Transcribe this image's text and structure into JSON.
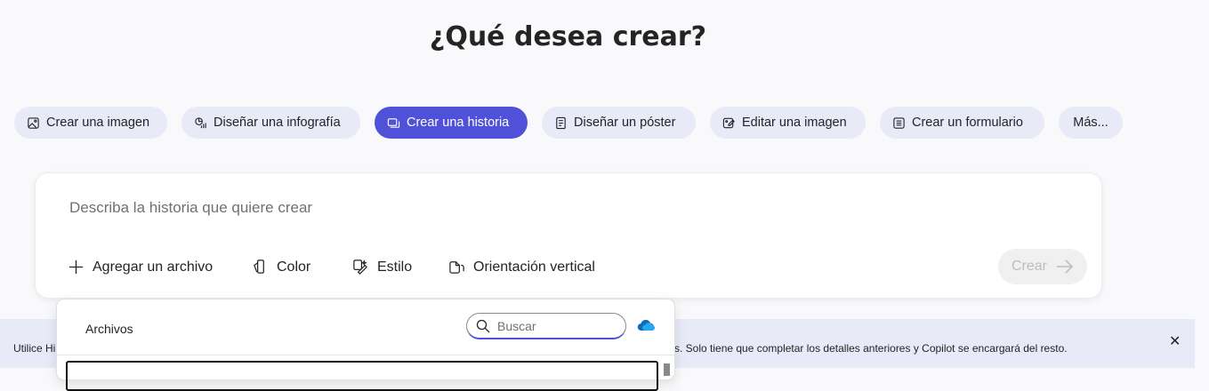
{
  "heading": "¿Qué desea crear?",
  "chips": [
    {
      "label": "Crear una imagen",
      "icon": "image-icon",
      "active": false
    },
    {
      "label": "Diseñar una infografía",
      "icon": "infographic-icon",
      "active": false
    },
    {
      "label": "Crear una historia",
      "icon": "story-icon",
      "active": true
    },
    {
      "label": "Diseñar un póster",
      "icon": "poster-icon",
      "active": false
    },
    {
      "label": "Editar una imagen",
      "icon": "edit-image-icon",
      "active": false
    },
    {
      "label": "Crear un formulario",
      "icon": "form-icon",
      "active": false
    },
    {
      "label": "Más...",
      "icon": "",
      "active": false
    }
  ],
  "prompt": {
    "placeholder": "Describa la historia que quiere crear",
    "value": ""
  },
  "tools": {
    "add_file": "Agregar un archivo",
    "color": "Color",
    "style": "Estilo",
    "orientation": "Orientación vertical"
  },
  "create_button": "Crear",
  "banner": {
    "text_left": "Utilice Hi",
    "text_right": "s. Solo tiene que completar los detalles anteriores y Copilot se encargará del resto."
  },
  "file_picker": {
    "title": "Archivos",
    "search_placeholder": "Buscar",
    "search_value": ""
  },
  "colors": {
    "accent": "#4f52d9",
    "chip_bg": "#e8eaf8",
    "page_bg": "#f9f9fb",
    "onedrive": "#0f6cbd"
  }
}
